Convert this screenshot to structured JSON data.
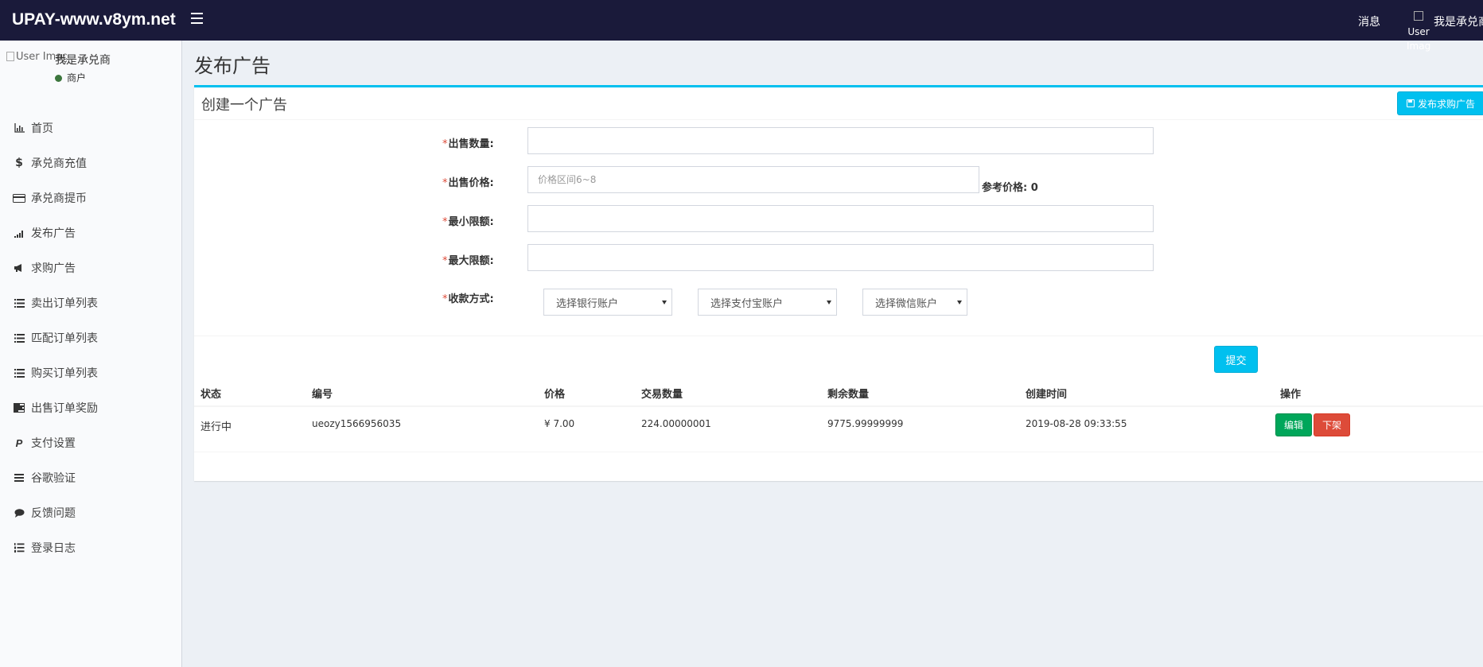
{
  "header": {
    "brand": "UPAY-www.v8ym.net",
    "messages_label": "消息",
    "user_image_alt": "User Image",
    "user_name": "我是承兑商"
  },
  "sidebar": {
    "user_image_alt": "User Image",
    "user_name": "我是承兑商",
    "user_status": "商户",
    "items": [
      {
        "label": "首页",
        "icon": "bar-chart-icon"
      },
      {
        "label": "承兑商充值",
        "icon": "dollar-icon"
      },
      {
        "label": "承兑商提币",
        "icon": "credit-card-icon"
      },
      {
        "label": "发布广告",
        "icon": "signal-icon"
      },
      {
        "label": "求购广告",
        "icon": "bullhorn-icon"
      },
      {
        "label": "卖出订单列表",
        "icon": "list-icon"
      },
      {
        "label": "匹配订单列表",
        "icon": "list-icon"
      },
      {
        "label": "购买订单列表",
        "icon": "list-icon"
      },
      {
        "label": "出售订单奖励",
        "icon": "tasks-icon"
      },
      {
        "label": "支付设置",
        "icon": "paypal-icon"
      },
      {
        "label": "谷歌验证",
        "icon": "bars-icon"
      },
      {
        "label": "反馈问题",
        "icon": "comment-icon"
      },
      {
        "label": "登录日志",
        "icon": "list-ol-icon"
      }
    ]
  },
  "page": {
    "title": "发布广告",
    "box_title": "创建一个广告",
    "publish_buy_button": "发布求购广告",
    "form": {
      "required_mark": "*",
      "sell_amount_label": "出售数量:",
      "sell_amount_value": "",
      "sell_price_label": "出售价格:",
      "sell_price_placeholder": "价格区间6~8",
      "ref_price_label": "参考价格:",
      "ref_price_value": "0",
      "min_limit_label": "最小限额:",
      "max_limit_label": "最大限额:",
      "payment_label": "收款方式:",
      "bank_select": "选择银行账户",
      "alipay_select": "选择支付宝账户",
      "wechat_select": "选择微信账户"
    },
    "submit_button": "提交",
    "table": {
      "headers": [
        "状态",
        "编号",
        "价格",
        "交易数量",
        "剩余数量",
        "创建时间",
        "操作"
      ],
      "rows": [
        {
          "status": "进行中",
          "id": "ueozy1566956035",
          "price": "¥ 7.00",
          "trade_qty": "224.00000001",
          "remain_qty": "9775.99999999",
          "created": "2019-08-28 09:33:55",
          "edit_label": "编辑",
          "off_label": "下架"
        }
      ]
    }
  }
}
